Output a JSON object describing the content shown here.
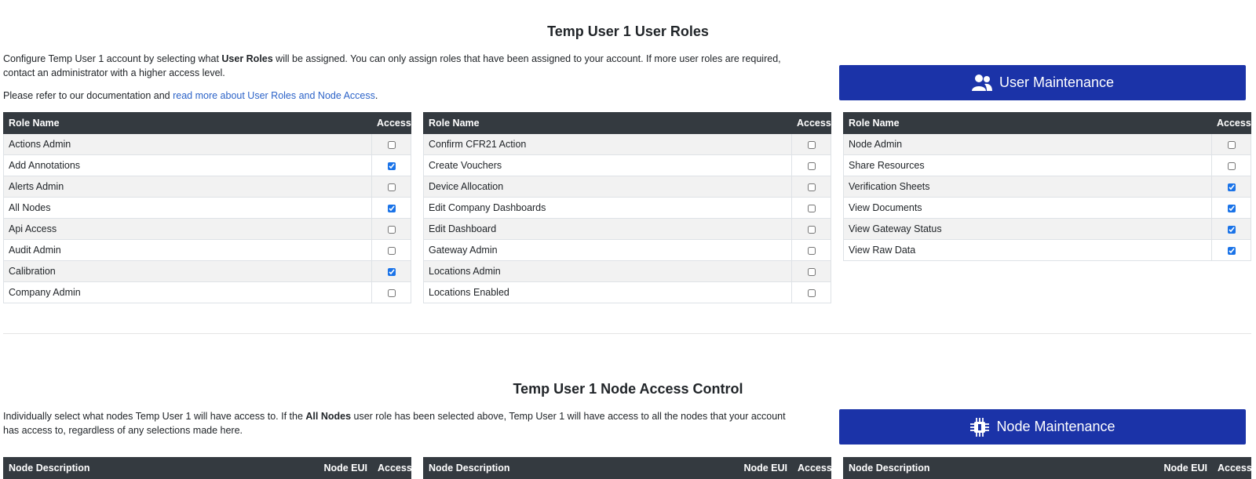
{
  "roles_section": {
    "title": "Temp User 1 User Roles",
    "intro_part1": "Configure Temp User 1 account by selecting what ",
    "intro_bold": "User Roles",
    "intro_part2": " will be assigned. You can only assign roles that have been assigned to your account. If more user roles are required, contact an administrator with a higher access level.",
    "doc_prefix": "Please refer to our documentation and ",
    "doc_link": "read more about User Roles and Node Access",
    "doc_suffix": ".",
    "button_label": "User Maintenance",
    "button_icon": "users-icon",
    "header_role": "Role Name",
    "header_access": "Access",
    "tables": [
      [
        {
          "name": "Actions Admin",
          "checked": false
        },
        {
          "name": "Add Annotations",
          "checked": true
        },
        {
          "name": "Alerts Admin",
          "checked": false
        },
        {
          "name": "All Nodes",
          "checked": true
        },
        {
          "name": "Api Access",
          "checked": false
        },
        {
          "name": "Audit Admin",
          "checked": false
        },
        {
          "name": "Calibration",
          "checked": true
        },
        {
          "name": "Company Admin",
          "checked": false
        }
      ],
      [
        {
          "name": "Confirm CFR21 Action",
          "checked": false
        },
        {
          "name": "Create Vouchers",
          "checked": false
        },
        {
          "name": "Device Allocation",
          "checked": false
        },
        {
          "name": "Edit Company Dashboards",
          "checked": false
        },
        {
          "name": "Edit Dashboard",
          "checked": false
        },
        {
          "name": "Gateway Admin",
          "checked": false
        },
        {
          "name": "Locations Admin",
          "checked": false
        },
        {
          "name": "Locations Enabled",
          "checked": false
        }
      ],
      [
        {
          "name": "Node Admin",
          "checked": false
        },
        {
          "name": "Share Resources",
          "checked": false
        },
        {
          "name": "Verification Sheets",
          "checked": true
        },
        {
          "name": "View Documents",
          "checked": true
        },
        {
          "name": "View Gateway Status",
          "checked": true
        },
        {
          "name": "View Raw Data",
          "checked": true
        }
      ]
    ]
  },
  "nodes_section": {
    "title": "Temp User 1 Node Access Control",
    "intro_part1": "Individually select what nodes Temp User 1 will have access to. If the ",
    "intro_bold": "All Nodes",
    "intro_part2": " user role has been selected above, Temp User 1 will have access to all the nodes that your account has access to, regardless of any selections made here.",
    "button_label": "Node Maintenance",
    "button_icon": "chip-icon",
    "header_desc": "Node Description",
    "header_eui": "Node EUI",
    "header_access": "Access"
  },
  "colors": {
    "primary_button": "#1b33a8",
    "table_header": "#343a40",
    "link": "#2c63c8"
  }
}
